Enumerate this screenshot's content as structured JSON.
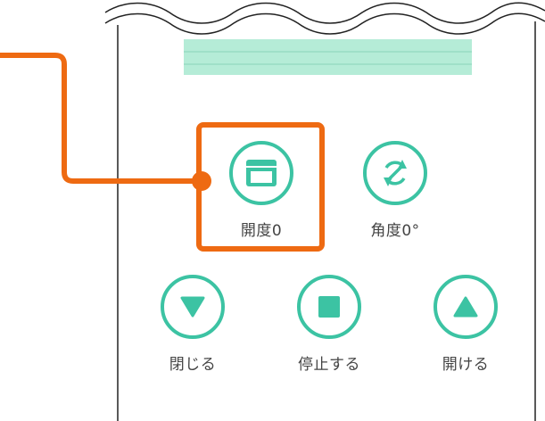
{
  "controls": {
    "opening": {
      "label": "開度0",
      "icon": "blind-open-level-icon"
    },
    "angle": {
      "label": "角度0°",
      "icon": "rotate-angle-icon"
    },
    "close": {
      "label": "閉じる",
      "icon": "triangle-down-icon"
    },
    "stop": {
      "label": "停止する",
      "icon": "square-stop-icon"
    },
    "open": {
      "label": "開ける",
      "icon": "triangle-up-icon"
    }
  },
  "colors": {
    "accent": "#3cc3a3",
    "highlight": "#ee6a12",
    "blind": "#b5ecd7",
    "text": "#444444",
    "frame": "#222222"
  }
}
